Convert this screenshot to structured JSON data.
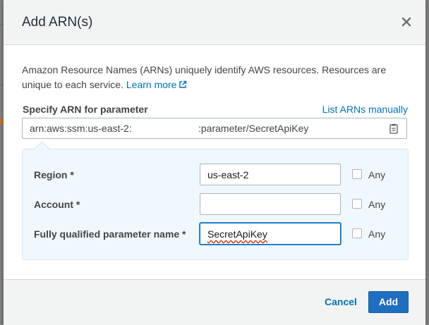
{
  "modal": {
    "title": "Add ARN(s)",
    "close_icon": "close-icon"
  },
  "description": {
    "text": "Amazon Resource Names (ARNs) uniquely identify AWS resources. Resources are unique to each service.",
    "link": "Learn more",
    "link_icon": "external-link-icon"
  },
  "arn": {
    "label": "Specify ARN for parameter",
    "list_manually": "List ARNs manually",
    "prefix": "arn:aws:ssm:us-east-2:",
    "suffix": ":parameter/SecretApiKey",
    "copy_icon": "clipboard-icon"
  },
  "fields": {
    "region": {
      "label": "Region *",
      "value": "us-east-2",
      "any": "Any"
    },
    "account": {
      "label": "Account *",
      "value": "",
      "any": "Any"
    },
    "param": {
      "label": "Fully qualified parameter name *",
      "value": "SecretApiKey",
      "any": "Any"
    }
  },
  "footer": {
    "cancel": "Cancel",
    "add": "Add"
  },
  "colors": {
    "link": "#0073bb",
    "primary_button": "#1f6fc1",
    "panel_bg": "#f0f8ff"
  }
}
